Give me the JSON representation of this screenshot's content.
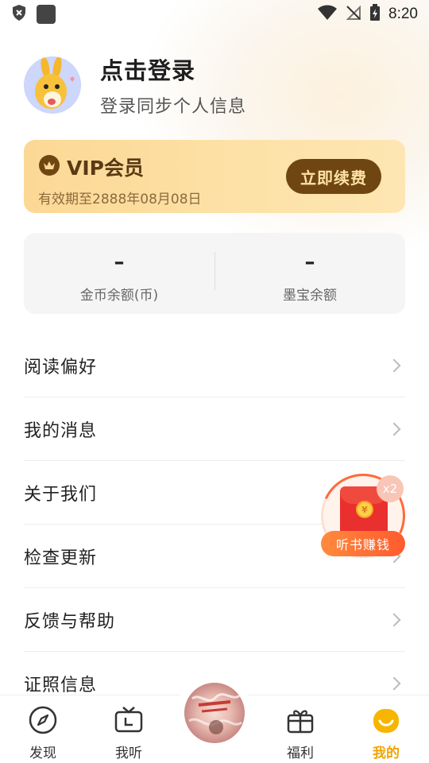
{
  "status_bar": {
    "time": "8:20",
    "icons": [
      "shield-x-icon",
      "app-square-icon",
      "wifi-icon",
      "no-signal-icon",
      "battery-charging-icon"
    ]
  },
  "profile": {
    "title": "点击登录",
    "subtitle": "登录同步个人信息",
    "avatar_icon": "kangaroo-avatar-icon"
  },
  "vip": {
    "title": "VIP会员",
    "expire_text": "有效期至2888年08月08日",
    "button_label": "立即续费",
    "icon": "vip-crown-icon",
    "colors": {
      "card": "#fcd895",
      "button": "#6f4611",
      "button_text": "#ffe2a6"
    }
  },
  "balance": {
    "items": [
      {
        "value": "–",
        "label": "金币余额(币)"
      },
      {
        "value": "–",
        "label": "墨宝余额"
      }
    ]
  },
  "menu": {
    "items": [
      {
        "label": "阅读偏好"
      },
      {
        "label": "我的消息"
      },
      {
        "label": "关于我们"
      },
      {
        "label": "检查更新"
      },
      {
        "label": "反馈与帮助"
      },
      {
        "label": "证照信息"
      }
    ]
  },
  "float_reward": {
    "badge": "x2",
    "label": "听书赚钱",
    "coin_symbol": "¥"
  },
  "tabbar": {
    "tabs": [
      {
        "label": "发现",
        "icon": "compass-icon"
      },
      {
        "label": "我听",
        "icon": "tv-icon"
      },
      {
        "label": "",
        "icon": "book-cover-disc-icon"
      },
      {
        "label": "福利",
        "icon": "gift-icon"
      },
      {
        "label": "我的",
        "icon": "profile-face-icon",
        "active": true
      }
    ],
    "active_color": "#f0a400"
  }
}
